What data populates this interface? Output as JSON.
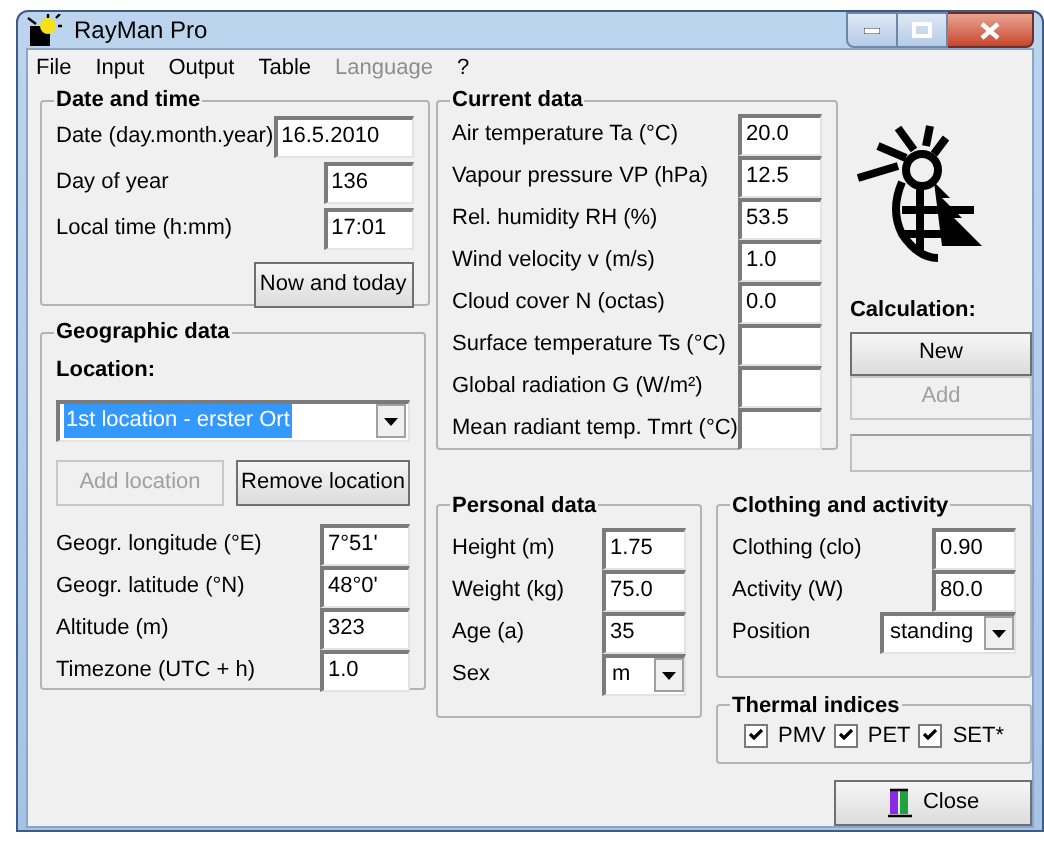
{
  "window": {
    "title": "RayMan Pro"
  },
  "menu": [
    {
      "label": "File",
      "disabled": false
    },
    {
      "label": "Input",
      "disabled": false
    },
    {
      "label": "Output",
      "disabled": false
    },
    {
      "label": "Table",
      "disabled": false
    },
    {
      "label": "Language",
      "disabled": true
    },
    {
      "label": "?",
      "disabled": false
    }
  ],
  "date_time": {
    "title": "Date and time",
    "fields": [
      {
        "label": "Date (day.month.year)",
        "value": "16.5.2010",
        "kind": "wide"
      },
      {
        "label": "Day of year",
        "value": "136",
        "kind": "text"
      },
      {
        "label": "Local time (h:mm)",
        "value": "17:01",
        "kind": "text"
      }
    ],
    "button": {
      "label": "Now and today"
    }
  },
  "geographic": {
    "title": "Geographic data",
    "location_label": "Location:",
    "location": {
      "value": "1st location - erster Ort",
      "highlighted": true
    },
    "buttons": [
      {
        "label": "Add location",
        "disabled": true
      },
      {
        "label": "Remove location",
        "disabled": false
      }
    ],
    "fields": [
      {
        "label": "Geogr. longitude (°E)",
        "value": "7°51'"
      },
      {
        "label": "Geogr. latitude (°N)",
        "value": "48°0'"
      },
      {
        "label": "Altitude (m)",
        "value": "323"
      },
      {
        "label": "Timezone (UTC + h)",
        "value": "1.0"
      }
    ]
  },
  "current_data": {
    "title": "Current data",
    "fields": [
      {
        "label": "Air temperature Ta (°C)",
        "value": "20.0"
      },
      {
        "label": "Vapour pressure VP (hPa)",
        "value": "12.5"
      },
      {
        "label": "Rel. humidity RH (%)",
        "value": "53.5"
      },
      {
        "label": "Wind velocity v (m/s)",
        "value": "1.0"
      },
      {
        "label": "Cloud cover N (octas)",
        "value": "0.0"
      },
      {
        "label": "Surface temperature Ts (°C)"
      },
      {
        "label": "Global radiation G (W/m²)"
      },
      {
        "label": "Mean radiant temp. Tmrt (°C)"
      }
    ]
  },
  "calculation": {
    "title": "Calculation:",
    "buttons": [
      {
        "label": "New",
        "disabled": false
      },
      {
        "label": "Add",
        "disabled": true
      }
    ]
  },
  "personal_data": {
    "title": "Personal data",
    "fields": [
      {
        "label": "Height (m)",
        "value": "1.75",
        "kind": "text"
      },
      {
        "label": "Weight (kg)",
        "value": "75.0",
        "kind": "text"
      },
      {
        "label": "Age (a)",
        "value": "35",
        "kind": "text"
      },
      {
        "label": "Sex",
        "value": "m",
        "kind": "select"
      }
    ]
  },
  "clothing_activity": {
    "title": "Clothing and activity",
    "fields": [
      {
        "label": "Clothing (clo)",
        "value": "0.90",
        "kind": "text"
      },
      {
        "label": "Activity (W)",
        "value": "80.0",
        "kind": "text"
      },
      {
        "label": "Position",
        "value": "standing",
        "kind": "select"
      }
    ]
  },
  "thermal_indices": {
    "title": "Thermal indices",
    "options": [
      {
        "label": "PMV",
        "checked": true
      },
      {
        "label": "PET",
        "checked": true
      },
      {
        "label": "SET*",
        "checked": true
      }
    ]
  },
  "close_button": {
    "label": "Close"
  }
}
